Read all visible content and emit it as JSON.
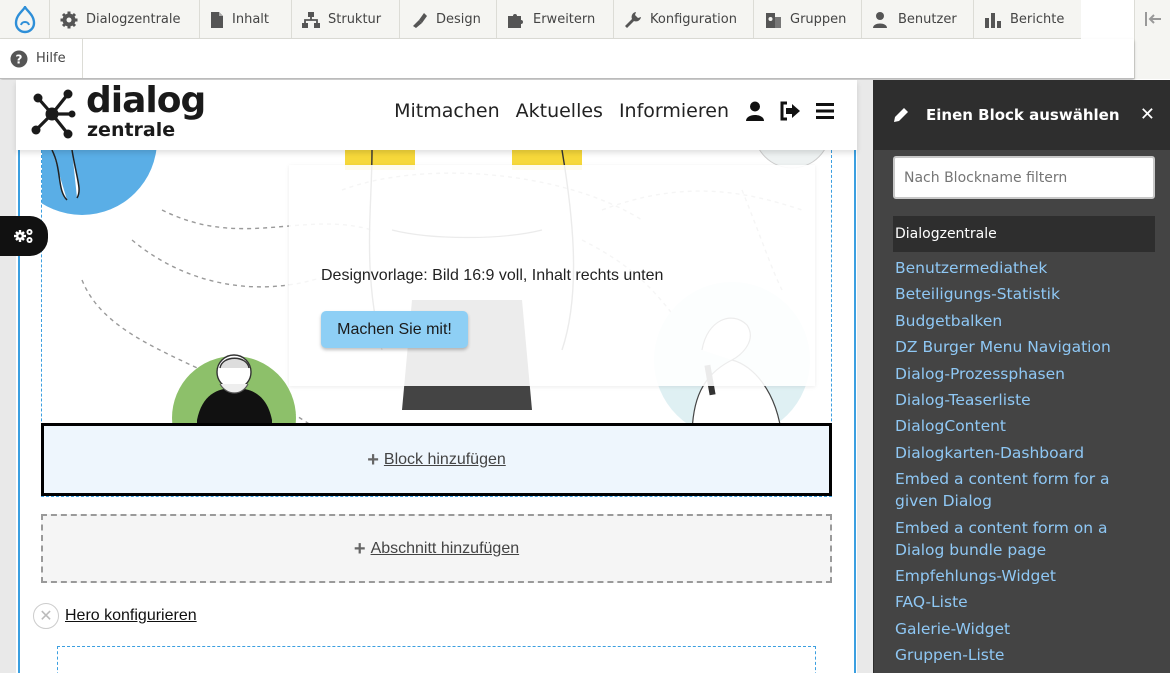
{
  "toolbar": {
    "items": [
      {
        "label": "Dialogzentrale",
        "icon": "gear-icon"
      },
      {
        "label": "Inhalt",
        "icon": "document-icon"
      },
      {
        "label": "Struktur",
        "icon": "hierarchy-icon"
      },
      {
        "label": "Design",
        "icon": "paint-brush-icon"
      },
      {
        "label": "Erweitern",
        "icon": "puzzle-icon"
      },
      {
        "label": "Konfiguration",
        "icon": "wrench-icon"
      },
      {
        "label": "Gruppen",
        "icon": "group-icon"
      },
      {
        "label": "Benutzer",
        "icon": "user-icon"
      },
      {
        "label": "Berichte",
        "icon": "bar-chart-icon"
      }
    ],
    "tray": {
      "help_label": "Hilfe"
    }
  },
  "site": {
    "logo": {
      "line1": "dialog",
      "line2": "zentrale"
    },
    "nav": [
      "Mitmachen",
      "Aktuelles",
      "Informieren"
    ],
    "hero": {
      "text": "Designvorlage: Bild 16:9 voll, Inhalt rechts unten",
      "button_label": "Machen Sie mit!"
    },
    "add_block_label": "Block hinzufügen",
    "add_section_label": "Abschnitt hinzufügen",
    "configure_label": "Hero konfigurieren"
  },
  "sidebar": {
    "title": "Einen Block auswählen",
    "search_placeholder": "Nach Blockname filtern",
    "group_label": "Dialogzentrale",
    "blocks": [
      "Benutzermediathek",
      "Beteiligungs-Statistik",
      "Budgetbalken",
      "DZ Burger Menu Navigation",
      "Dialog-Prozessphasen",
      "Dialog-Teaserliste",
      "DialogContent",
      "Dialogkarten-Dashboard",
      "Embed a content form for a given Dialog",
      "Embed a content form on a Dialog bundle page",
      "Empfehlungs-Widget",
      "FAQ-Liste",
      "Galerie-Widget",
      "Gruppen-Liste"
    ]
  },
  "colors": {
    "accent_blue": "#3b9fe0",
    "button_blue": "#8ecff5",
    "sidebar_bg": "#444444",
    "sidebar_link": "#8fc8f5"
  }
}
